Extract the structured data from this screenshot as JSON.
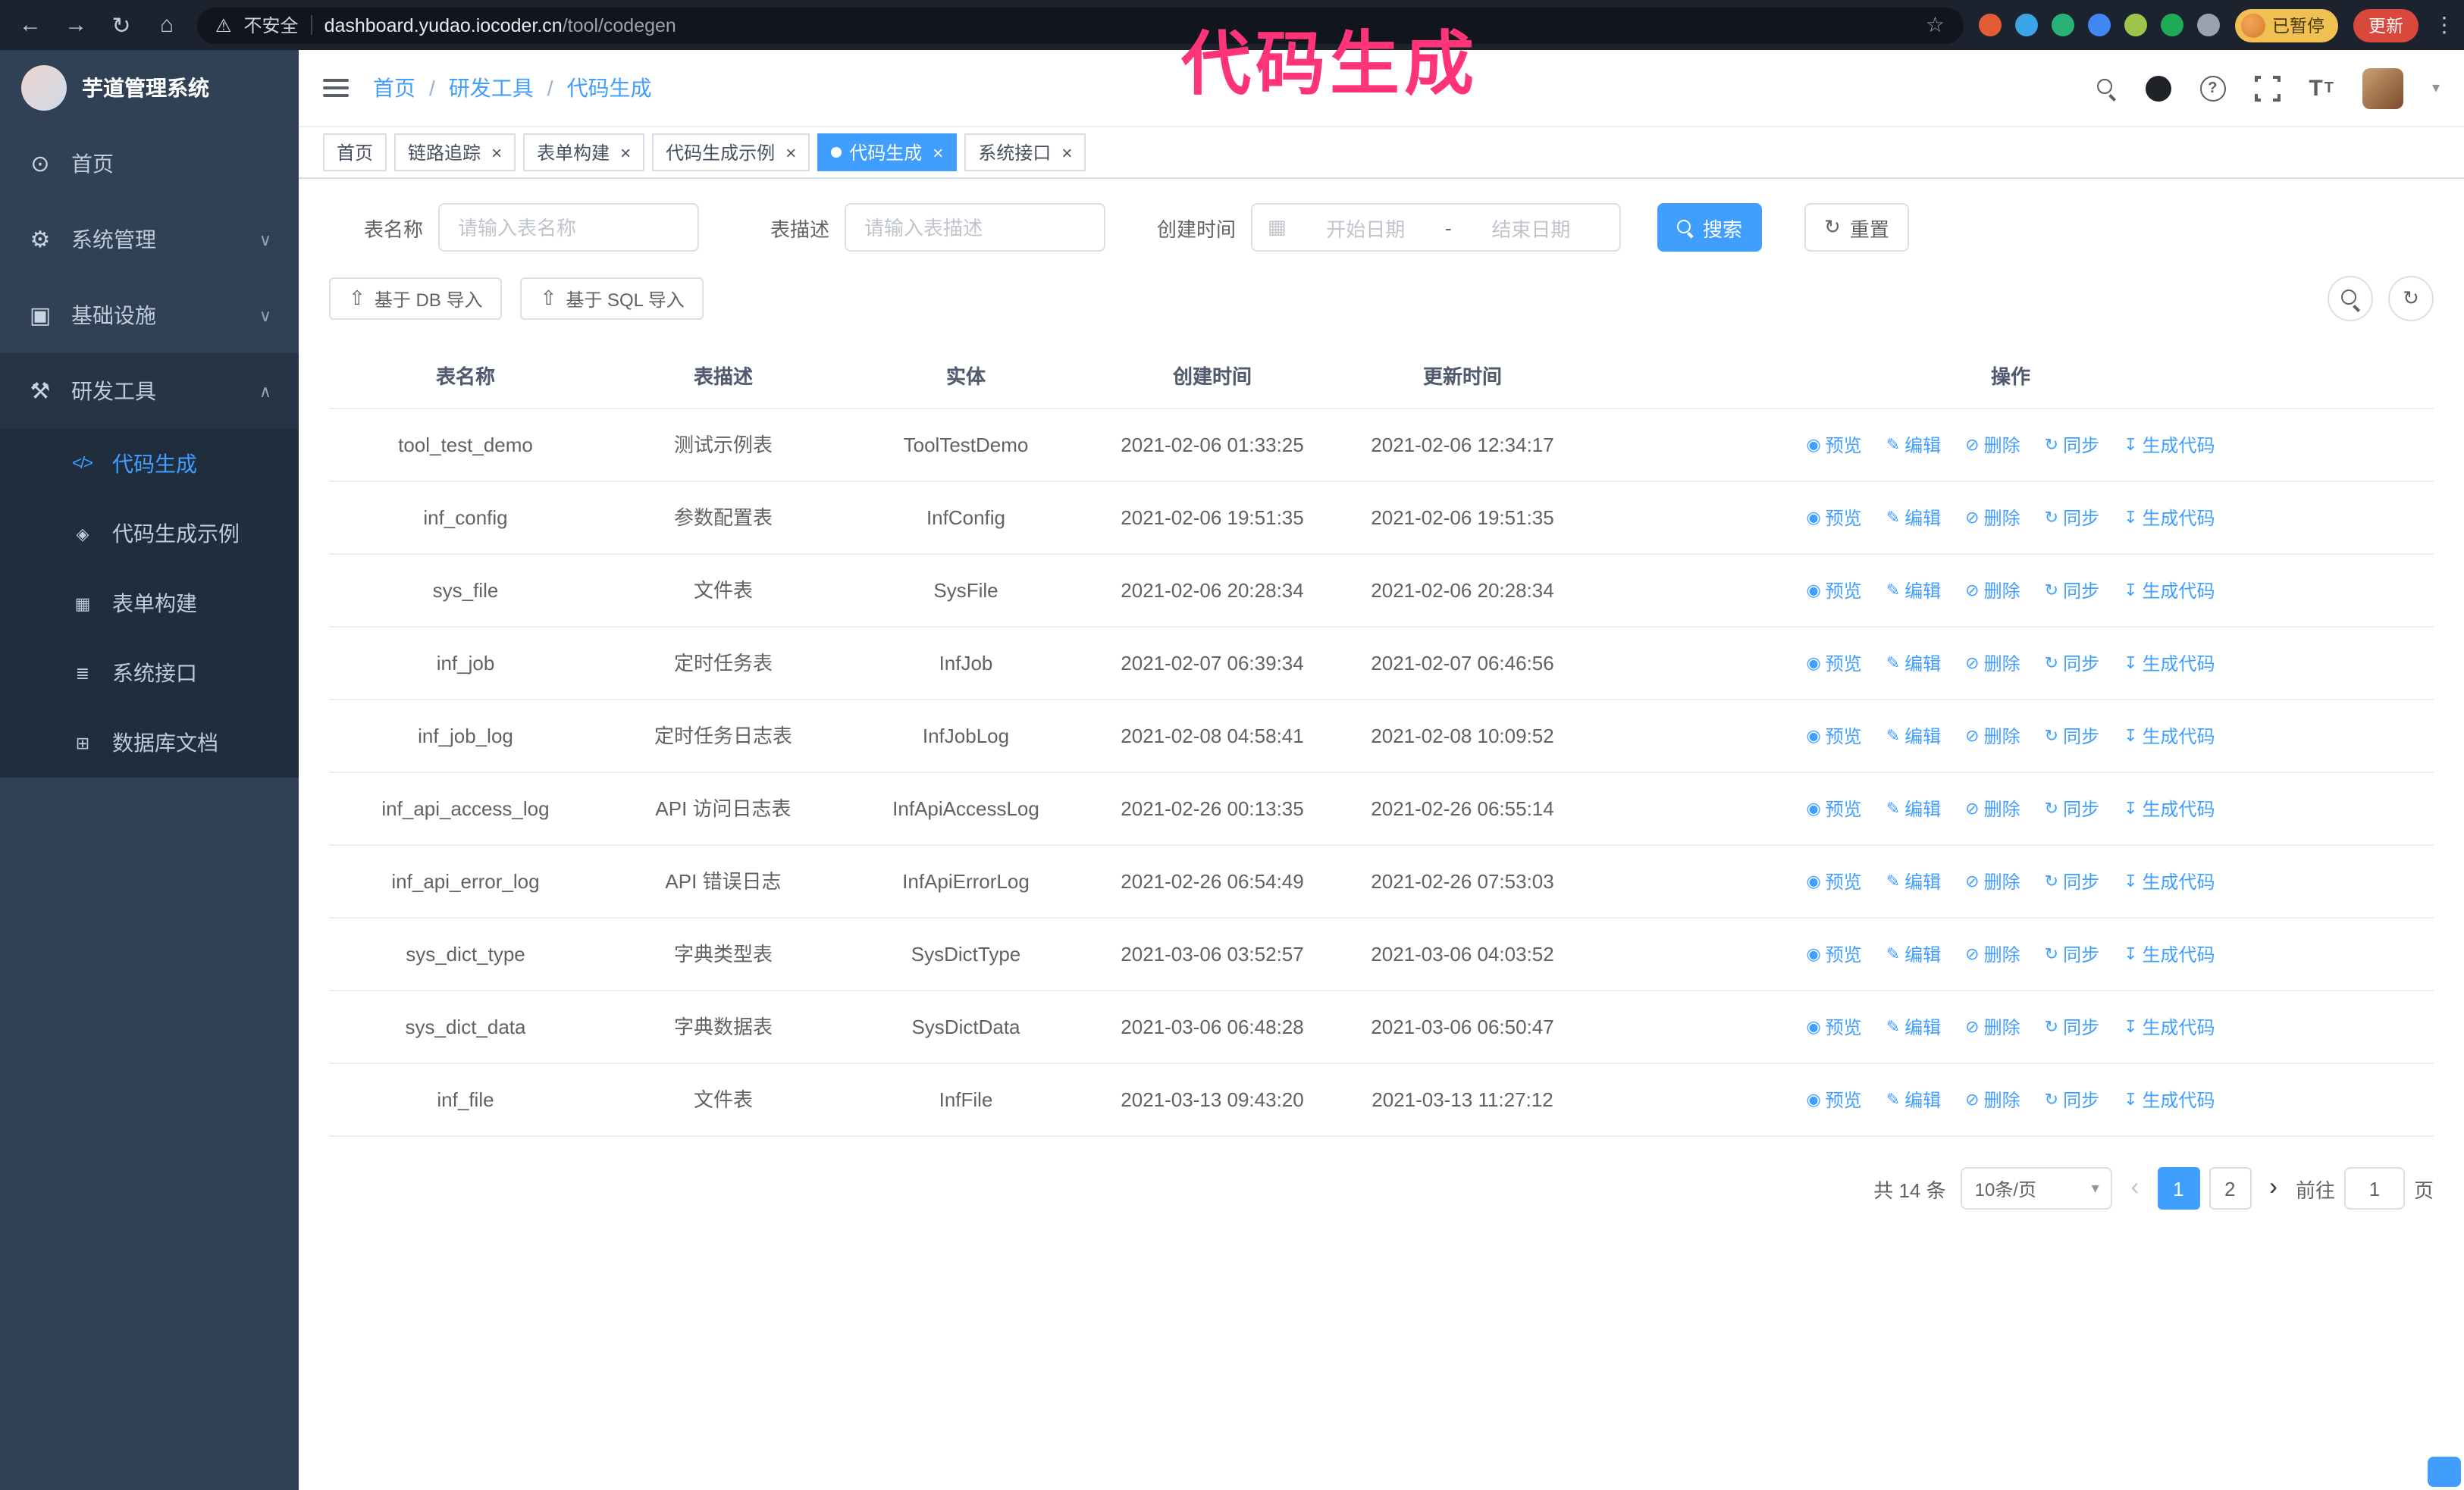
{
  "browser": {
    "security_label": "不安全",
    "url_host": "dashboard.yudao.iocoder.cn",
    "url_path": "/tool/codegen",
    "paused_badge": "已暂停",
    "update_button": "更新",
    "extensions": [
      {
        "name": "extension-icon-shield",
        "color": "#e25d33"
      },
      {
        "name": "extension-icon-drop",
        "color": "#3ba3e8"
      },
      {
        "name": "extension-icon-check",
        "color": "#27b376"
      },
      {
        "name": "extension-icon-people",
        "color": "#4285f4"
      },
      {
        "name": "extension-icon-card",
        "color": "#9ec54a"
      },
      {
        "name": "extension-icon-leaf",
        "color": "#1faa59"
      },
      {
        "name": "extension-icon-pawn",
        "color": "#9aa3ad"
      }
    ]
  },
  "annotation": {
    "text": "代码生成",
    "color": "#ff3377"
  },
  "icons": {
    "back": "←",
    "forward": "→",
    "reload": "↻",
    "home": "⌂",
    "warning": "⚠",
    "star": "☆",
    "dots": "⋮",
    "help": "?",
    "caret_down": "▾",
    "calendar": "▦",
    "refresh": "↻",
    "upload": "⇧",
    "close": "×",
    "pager_prev": "‹",
    "pager_next": "›"
  },
  "sidebar": {
    "logo_title": "芋道管理系统",
    "items": [
      {
        "label": "首页",
        "glyph": "⊙",
        "icon": "dashboard-icon",
        "name": "sidebar-item-home"
      },
      {
        "label": "系统管理",
        "glyph": "⚙",
        "icon": "gear-icon",
        "chevron": "∨",
        "expandable": true,
        "name": "sidebar-item-system"
      },
      {
        "label": "基础设施",
        "glyph": "▣",
        "icon": "infrastructure-icon",
        "chevron": "∨",
        "expandable": true,
        "name": "sidebar-item-infra"
      },
      {
        "label": "研发工具",
        "glyph": "⚒",
        "icon": "tools-icon",
        "chevron": "∧",
        "expandable": true,
        "expanded": true,
        "name": "sidebar-item-devtools"
      }
    ],
    "subitems": [
      {
        "label": "代码生成",
        "glyph": "</>",
        "icon": "code-icon",
        "active": true,
        "name": "sidebar-item-codegen"
      },
      {
        "label": "代码生成示例",
        "glyph": "◈",
        "icon": "example-icon",
        "name": "sidebar-item-codegen-example"
      },
      {
        "label": "表单构建",
        "glyph": "▦",
        "icon": "form-icon",
        "name": "sidebar-item-form-builder"
      },
      {
        "label": "系统接口",
        "glyph": "≣",
        "icon": "api-icon",
        "name": "sidebar-item-api"
      },
      {
        "label": "数据库文档",
        "glyph": "⊞",
        "icon": "database-doc-icon",
        "name": "sidebar-item-db-doc"
      }
    ]
  },
  "header": {
    "breadcrumb": [
      "首页",
      "研发工具",
      "代码生成"
    ]
  },
  "tabs": [
    {
      "label": "首页",
      "closable": false,
      "active": false
    },
    {
      "label": "链路追踪",
      "closable": true,
      "active": false
    },
    {
      "label": "表单构建",
      "closable": true,
      "active": false
    },
    {
      "label": "代码生成示例",
      "closable": true,
      "active": false
    },
    {
      "label": "代码生成",
      "closable": true,
      "active": true
    },
    {
      "label": "系统接口",
      "closable": true,
      "active": false
    }
  ],
  "filters": {
    "table_name_label": "表名称",
    "table_name_placeholder": "请输入表名称",
    "table_desc_label": "表描述",
    "table_desc_placeholder": "请输入表描述",
    "create_time_label": "创建时间",
    "date_start_placeholder": "开始日期",
    "date_separator": "-",
    "date_end_placeholder": "结束日期",
    "search_button": "搜索",
    "reset_button": "重置"
  },
  "toolbar": {
    "import_db_button": "基于 DB 导入",
    "import_sql_button": "基于 SQL 导入"
  },
  "table": {
    "columns": [
      "表名称",
      "表描述",
      "实体",
      "创建时间",
      "更新时间",
      "操作"
    ],
    "actions": [
      {
        "label": "预览",
        "icon": "eye-icon",
        "glyph": "◉",
        "name": "preview-action-link"
      },
      {
        "label": "编辑",
        "icon": "edit-icon",
        "glyph": "✎",
        "name": "edit-action-link"
      },
      {
        "label": "删除",
        "icon": "trash-icon",
        "glyph": "⊘",
        "name": "delete-action-link"
      },
      {
        "label": "同步",
        "icon": "sync-icon",
        "glyph": "↻",
        "name": "sync-action-link"
      },
      {
        "label": "生成代码",
        "icon": "download-icon",
        "glyph": "↧",
        "name": "generate-code-action-link"
      }
    ],
    "rows": [
      {
        "name": "tool_test_demo",
        "desc": "测试示例表",
        "entity": "ToolTestDemo",
        "created": "2021-02-06 01:33:25",
        "updated": "2021-02-06 12:34:17"
      },
      {
        "name": "inf_config",
        "desc": "参数配置表",
        "entity": "InfConfig",
        "created": "2021-02-06 19:51:35",
        "updated": "2021-02-06 19:51:35"
      },
      {
        "name": "sys_file",
        "desc": "文件表",
        "entity": "SysFile",
        "created": "2021-02-06 20:28:34",
        "updated": "2021-02-06 20:28:34"
      },
      {
        "name": "inf_job",
        "desc": "定时任务表",
        "entity": "InfJob",
        "created": "2021-02-07 06:39:34",
        "updated": "2021-02-07 06:46:56"
      },
      {
        "name": "inf_job_log",
        "desc": "定时任务日志表",
        "entity": "InfJobLog",
        "created": "2021-02-08 04:58:41",
        "updated": "2021-02-08 10:09:52"
      },
      {
        "name": "inf_api_access_log",
        "desc": "API 访问日志表",
        "entity": "InfApiAccessLog",
        "created": "2021-02-26 00:13:35",
        "updated": "2021-02-26 06:55:14"
      },
      {
        "name": "inf_api_error_log",
        "desc": "API 错误日志",
        "entity": "InfApiErrorLog",
        "created": "2021-02-26 06:54:49",
        "updated": "2021-02-26 07:53:03"
      },
      {
        "name": "sys_dict_type",
        "desc": "字典类型表",
        "entity": "SysDictType",
        "created": "2021-03-06 03:52:57",
        "updated": "2021-03-06 04:03:52"
      },
      {
        "name": "sys_dict_data",
        "desc": "字典数据表",
        "entity": "SysDictData",
        "created": "2021-03-06 06:48:28",
        "updated": "2021-03-06 06:50:47"
      },
      {
        "name": "inf_file",
        "desc": "文件表",
        "entity": "InfFile",
        "created": "2021-03-13 09:43:20",
        "updated": "2021-03-13 11:27:12"
      }
    ]
  },
  "pagination": {
    "total": "共 14 条",
    "page_size": "10条/页",
    "pages": [
      {
        "label": "1",
        "active": true
      },
      {
        "label": "2",
        "active": false
      }
    ],
    "goto_label": "前往",
    "goto_value": "1",
    "goto_suffix": "页"
  },
  "colors": {
    "accent": "#409eff",
    "annotation": "#ff3377",
    "sidebar_bg": "#304156",
    "submenu_bg": "#1f2d3d",
    "chrome_bg": "#1d232e",
    "update_button_bg": "#d9483b",
    "paused_badge_bg": "#f0c052"
  }
}
